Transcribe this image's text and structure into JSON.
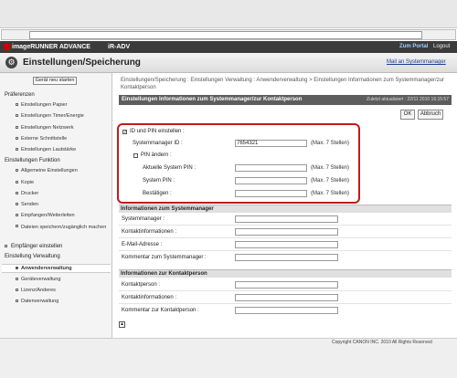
{
  "browser": {
    "address_value": "",
    "dropdown_glyph": "▾"
  },
  "brand": {
    "name": "imageRUNNER ADVANCE",
    "model": "iR-ADV",
    "portal": "Zum Portal",
    "logout": "Logout"
  },
  "title": {
    "text": "Einstellungen/Speicherung",
    "mail_link": "Mail an Systemmanager",
    "icon": "settings-icon"
  },
  "sidebar": {
    "restart_label": "Gerät neu starten",
    "groups": [
      {
        "label": "Präferenzen"
      },
      {
        "label": "Einstellungen Funktion"
      },
      {
        "label": "Empfänger einstellen"
      },
      {
        "label": "Einstellung Verwaltung"
      }
    ],
    "items": [
      "Einstellungen Papier",
      "Einstellungen Timer/Energie",
      "Einstellungen Netzwerk",
      "Externe Schnittstelle",
      "Einstellungen Lautstärke",
      "Allgemeine Einstellungen",
      "Kopie",
      "Drucker",
      "Senden",
      "Empfangen/Weiterleiten",
      "Dateien speichern/zugänglich machen",
      "Anwenderverwaltung",
      "Geräteverwaltung",
      "Lizenz/Anderes",
      "Datenverwaltung"
    ]
  },
  "content": {
    "breadcrumb": "Einstellungen/Speicherung : Einstellungen Verwaltung : Anwenderverwaltung > Einstellungen Informationen zum Systemmanager/zur Kontaktperson",
    "section_title": "Einstellungen Informationen zum Systemmanager/zur Kontaktperson",
    "updated": "Zuletzt aktualisiert : 22/11 2010 16:15:57",
    "ok_label": "OK",
    "cancel_label": "Abbruch",
    "id_pin": {
      "checkbox_label": "ID und PIN einstellen :",
      "checked_mark": "✓",
      "manager_id_label": "Systemmanager ID :",
      "manager_id_value": "7654321",
      "hint": "(Max. 7 Stellen)",
      "pin_change_label": "PIN ändern :",
      "current_pin_label": "Aktuelle System PIN :",
      "system_pin_label": "System PIN :",
      "confirm_label": "Bestätigen :"
    },
    "manager_info": {
      "heading": "Informationen zum Systemmanager",
      "rows": [
        "Systemmanager :",
        "Kontaktinformationen :",
        "E-Mail-Adresse :",
        "Kommentar zum Systemmanager :"
      ]
    },
    "contact_info": {
      "heading": "Informationen zur Kontaktperson",
      "rows": [
        "Kontaktperson :",
        "Kontaktinformationen :",
        "Kommentar zur Kontaktperson :"
      ]
    },
    "top_icon": "▲"
  },
  "footer": {
    "copyright": "Copyright CANON INC. 2010 All Rights Reserved"
  }
}
